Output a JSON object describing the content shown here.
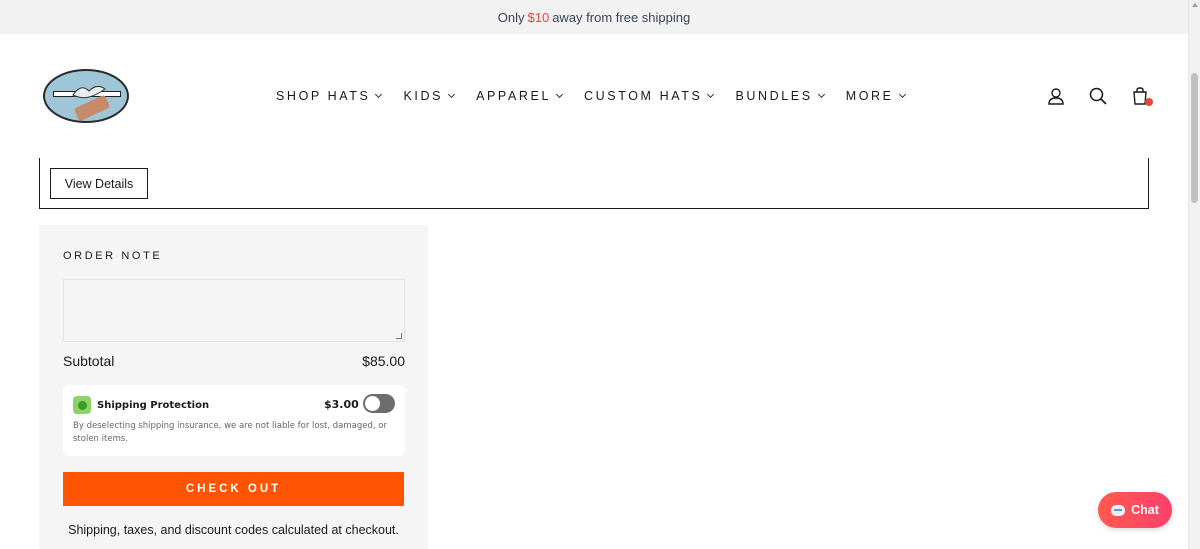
{
  "announcement": {
    "prefix": "Only",
    "amount": "$10",
    "suffix": "away from free shipping"
  },
  "nav": {
    "items": [
      {
        "label": "SHOP HATS"
      },
      {
        "label": "KIDS"
      },
      {
        "label": "APPAREL"
      },
      {
        "label": "CUSTOM HATS"
      },
      {
        "label": "BUNDLES"
      },
      {
        "label": "MORE"
      }
    ]
  },
  "header_icons": [
    "account-icon",
    "search-icon",
    "cart-icon"
  ],
  "cart": {
    "view_details_label": "View Details"
  },
  "order": {
    "note_label": "ORDER NOTE",
    "note_value": "",
    "subtotal_label": "Subtotal",
    "subtotal_value": "$85.00",
    "protection": {
      "title": "Shipping Protection",
      "price": "$3.00",
      "enabled": false,
      "description": "By deselecting shipping insurance, we are not liable for lost, damaged, or stolen items."
    },
    "checkout_label": "CHECK OUT",
    "shipping_note": "Shipping, taxes, and discount codes calculated at checkout."
  },
  "chat": {
    "label": "Chat"
  },
  "colors": {
    "accent": "#ff5404",
    "announce_amount": "#e8453c",
    "chat_start": "#ff5a4f",
    "chat_end": "#ff3f6c"
  }
}
